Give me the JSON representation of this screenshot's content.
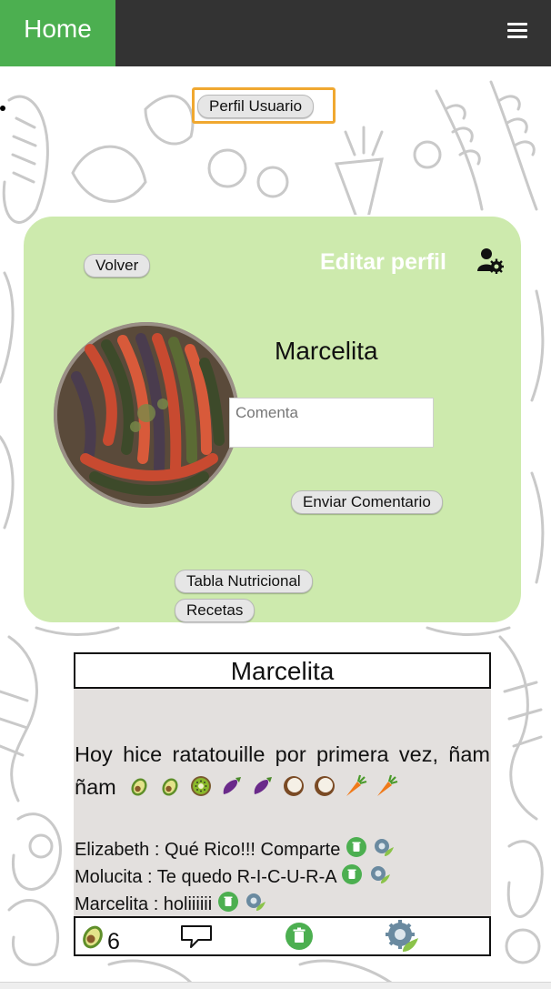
{
  "nav": {
    "home_label": "Home",
    "menu_icon": "hamburger-menu-icon",
    "bar_color": "#333333",
    "home_color": "#4caf50"
  },
  "profile_button_label": "Perfil Usuario",
  "profile_card": {
    "back_label": "Volver",
    "edit_title": "Editar perfil",
    "edit_icon": "user-gear-icon",
    "user_name": "Marcelita",
    "comment_placeholder": "Comenta",
    "send_comment_label": "Enviar Comentario",
    "nutrition_table_label": "Tabla Nutricional",
    "recipes_label": "Recetas",
    "card_color": "#cdeaad"
  },
  "post": {
    "author": "Marcelita",
    "text": "Hoy hice ratatouille por primera vez, ñam ñam",
    "emojis": [
      "avocado",
      "avocado",
      "kiwi",
      "eggplant",
      "eggplant",
      "coconut",
      "coconut",
      "carrot",
      "carrot"
    ],
    "comments": [
      {
        "text": "Elizabeth : Qué Rico!!! Comparte"
      },
      {
        "text": "Molucita : Te quedo R-I-C-U-R-A"
      },
      {
        "text": "Marcelita : holiiiiii"
      }
    ],
    "likes": "6",
    "footer_icons": [
      "avocado-like-icon",
      "comment-bubble-icon",
      "delete-trash-icon",
      "edit-gear-icon"
    ],
    "body_color": "#e3e0de"
  }
}
